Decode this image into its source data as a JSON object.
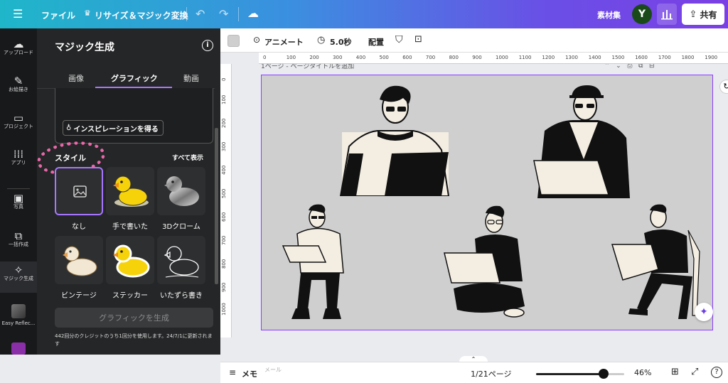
{
  "topbar": {
    "file_label": "ファイル",
    "resize_label": "リサイズ＆マジック変換",
    "assets_label": "素材集",
    "avatar_letter": "Y",
    "share_label": "共有"
  },
  "rail": {
    "items": [
      {
        "label": "アップロード",
        "icon": "cloud-upload-icon"
      },
      {
        "label": "お絵描き",
        "icon": "pen-icon"
      },
      {
        "label": "プロジェクト",
        "icon": "folder-icon"
      },
      {
        "label": "アプリ",
        "icon": "apps-grid-icon"
      },
      {
        "label": "写真",
        "icon": "photo-icon"
      },
      {
        "label": "一括作成",
        "icon": "bulk-create-icon"
      },
      {
        "label": "マジック生成",
        "icon": "magic-generate-icon"
      },
      {
        "label": "Easy Reflec...",
        "icon": "app-thumbnail"
      }
    ]
  },
  "panel": {
    "title": "マジック生成",
    "tabs": [
      "画像",
      "グラフィック",
      "動画"
    ],
    "inspiration_label": "インスピレーションを得る",
    "style_heading": "スタイル",
    "show_all": "すべて表示",
    "styles": [
      "なし",
      "手で書いた",
      "3Dクローム",
      "ビンテージ",
      "ステッカー",
      "いたずら書き"
    ],
    "generate_button": "グラフィックを生成",
    "credits_note": "442回分のクレジットのうち1回分を使用します。24/7/1に更新されます"
  },
  "canvas_toolbar": {
    "animate_label": "アニメート",
    "duration_label": "5.0秒",
    "position_label": "配置"
  },
  "page_title_partial": "1ページ - ページタイトルを追加",
  "rulers": {
    "h": [
      "0",
      "100",
      "200",
      "300",
      "400",
      "500",
      "600",
      "700",
      "800",
      "900",
      "1000",
      "1100",
      "1200",
      "1300",
      "1400",
      "1500",
      "1600",
      "1700",
      "1800",
      "1900"
    ],
    "v": [
      "0",
      "100",
      "200",
      "300",
      "400",
      "500",
      "600",
      "700",
      "800",
      "900",
      "1000"
    ]
  },
  "bottombar": {
    "notes_label": "メモ",
    "mail_hint": "メール",
    "page_indicator": "1/21ページ",
    "zoom_percent": "46%",
    "zoom_level": 0.46
  },
  "colors": {
    "accent": "#8b3dff",
    "panel_bg": "#252627",
    "rail_bg": "#18191b",
    "annotation": "#ff6fb8"
  }
}
